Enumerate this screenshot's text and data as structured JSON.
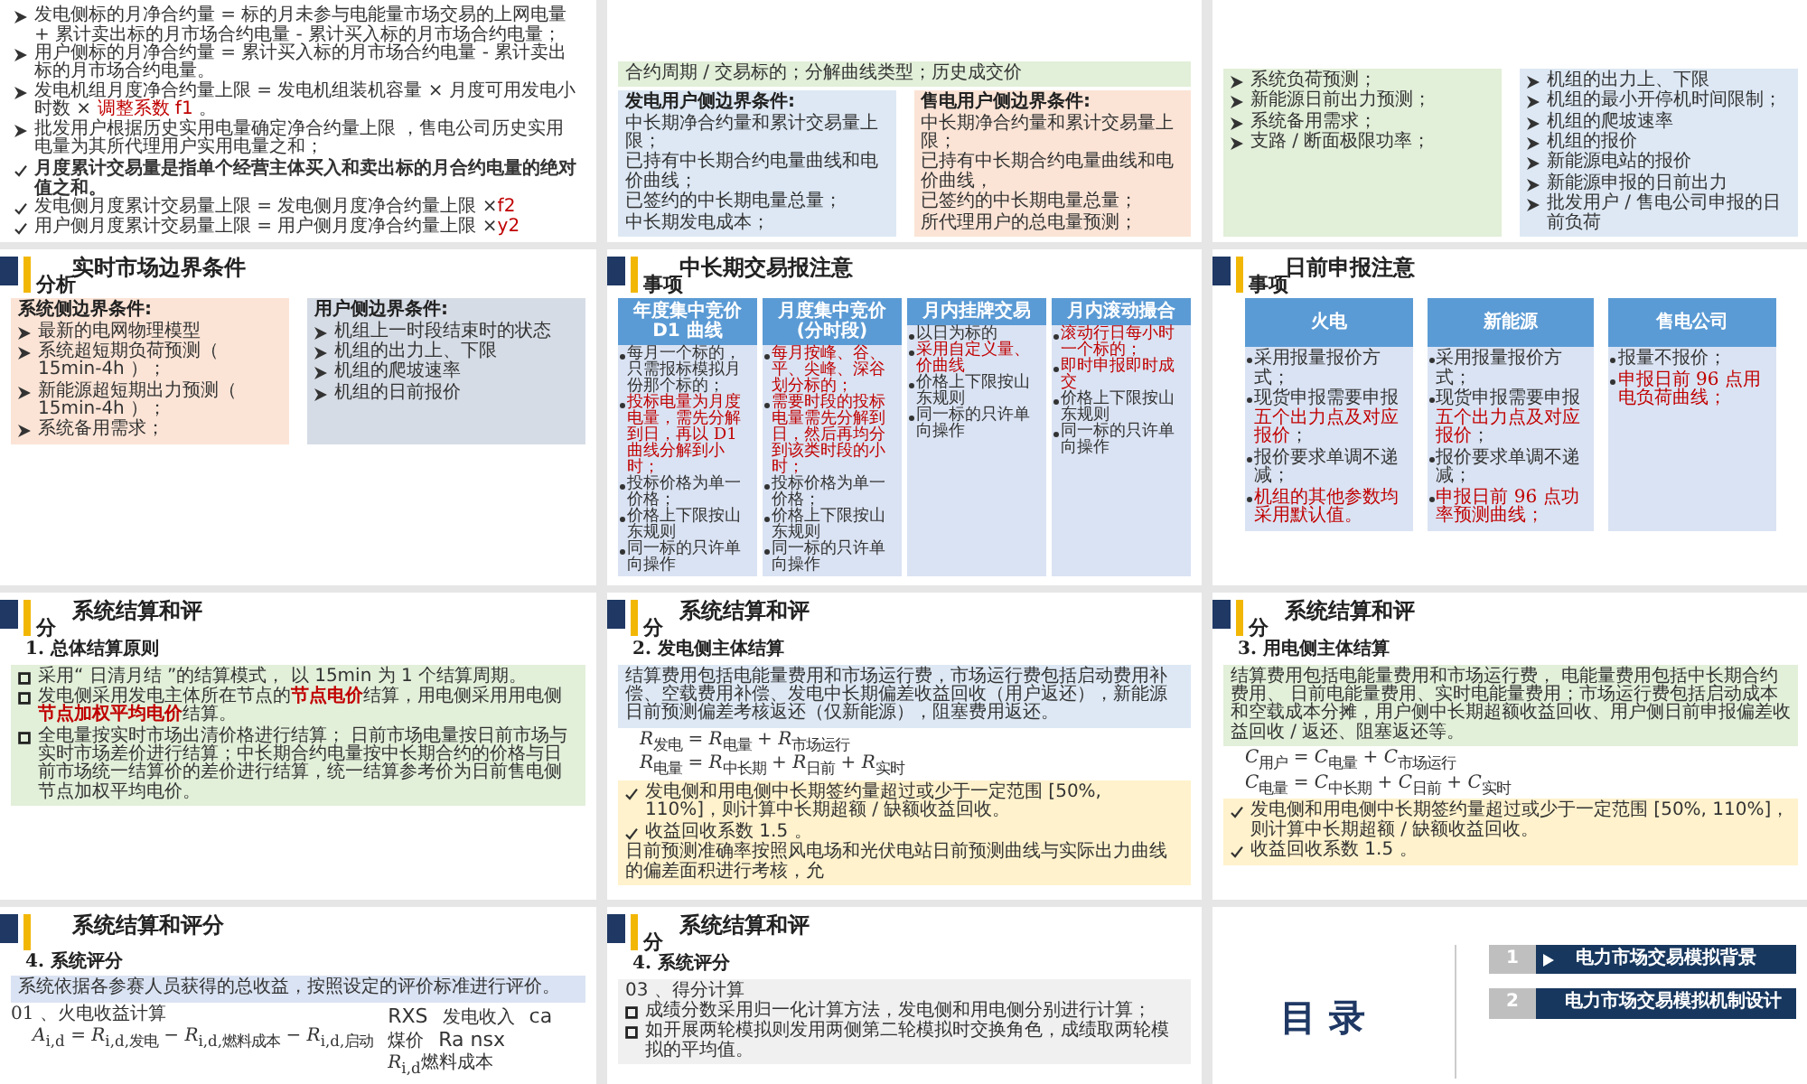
{
  "slides": [
    {
      "kind": "content",
      "blocks": [
        {
          "kind": "box",
          "items": [
            {
              "kind": "arrow",
              "bold": false,
              "parts": [
                {
                  "text": "发电侧标的月净合约量 = 标的月未参与电能量市场交易的上网电量 + 累计卖出标的月市场合约电量 - 累计买入标的月市场合约电量；",
                  "red": false
                }
              ]
            },
            {
              "kind": "arrow",
              "bold": false,
              "parts": [
                {
                  "text": "用户侧标的月净合约量 = 累计买入标的月市场合约电量 - 累计卖出标的月市场合约电量。",
                  "red": false
                }
              ]
            },
            {
              "kind": "arrow",
              "bold": false,
              "parts": [
                {
                  "text": "发电机组月度净合约量上限 = 发电机组装机容量 × 月度可用发电小时数 × ",
                  "red": false
                },
                {
                  "text": "调整系数 f1",
                  "red": true
                },
                {
                  "text": " 。",
                  "red": false
                }
              ]
            },
            {
              "kind": "arrow",
              "bold": false,
              "parts": [
                {
                  "text": "批发用户根据历史实用电量确定净合约量上限 ，售电公司历史实用电量为其所代理用户实用电量之和；",
                  "red": false
                }
              ]
            }
          ]
        },
        {
          "kind": "box",
          "items": [
            {
              "kind": "check",
              "bold": true,
              "parts": [
                {
                  "text": "月度累计交易量是指单个经营主体买入和卖出标的月合约电量的绝对值之和。",
                  "red": false
                }
              ]
            },
            {
              "kind": "check",
              "bold": false,
              "parts": [
                {
                  "text": "发电侧月度累计交易量上限 = 发电侧月度净合约量上限 ×",
                  "red": false
                },
                {
                  "text": "f2",
                  "red": true
                }
              ]
            },
            {
              "kind": "check",
              "bold": false,
              "parts": [
                {
                  "text": "用户侧月度累计交易量上限 = 用户侧月度净合约量上限 ×",
                  "red": false
                },
                {
                  "text": "y2",
                  "red": true
                }
              ]
            }
          ]
        }
      ]
    },
    {
      "kind": "content",
      "blocks": [
        {
          "kind": "box",
          "color": "#e2efd9",
          "items": [
            {
              "kind": "plain",
              "parts": [
                {
                  "text": "合约周期 / 交易标的；分解曲线类型；历史成交价",
                  "red": false
                }
              ]
            }
          ]
        },
        {
          "kind": "row",
          "boxes": [
            {
              "color": "#dde8f4",
              "heading": "发电用户侧边界条件:",
              "items": [
                {
                  "kind": "plain",
                  "parts": [
                    {
                      "text": "中长期净合约量和累计交易量上限；",
                      "red": false
                    }
                  ]
                },
                {
                  "kind": "plain",
                  "parts": [
                    {
                      "text": "已持有中长期合约电量曲线和电价曲线；",
                      "red": false
                    }
                  ]
                },
                {
                  "kind": "plain",
                  "parts": [
                    {
                      "text": "已签约的中长期电量总量；",
                      "red": false
                    }
                  ]
                },
                {
                  "kind": "plain",
                  "parts": [
                    {
                      "text": "中长期发电成本；",
                      "red": false
                    }
                  ]
                }
              ]
            },
            {
              "color": "#fbe4d6",
              "heading": "售电用户侧边界条件:",
              "items": [
                {
                  "kind": "plain",
                  "parts": [
                    {
                      "text": "中长期净合约量和累计交易量上限；",
                      "red": false
                    }
                  ]
                },
                {
                  "kind": "plain",
                  "parts": [
                    {
                      "text": "已持有中长期合约电量曲线和电价曲线，",
                      "red": false
                    }
                  ]
                },
                {
                  "kind": "plain",
                  "parts": [
                    {
                      "text": "已签约的中长期电量总量；",
                      "red": false
                    }
                  ]
                },
                {
                  "kind": "plain",
                  "parts": [
                    {
                      "text": "所代理用户的总电量预测；",
                      "red": false
                    }
                  ]
                }
              ]
            }
          ]
        }
      ]
    },
    {
      "kind": "content",
      "blocks": [
        {
          "kind": "row",
          "boxes": [
            {
              "color": "#e2efd9",
              "items": [
                {
                  "kind": "arrow",
                  "parts": [
                    {
                      "text": "系统负荷预测；",
                      "red": false
                    }
                  ]
                },
                {
                  "kind": "arrow",
                  "parts": [
                    {
                      "text": "新能源日前出力预测；",
                      "red": false
                    }
                  ]
                },
                {
                  "kind": "arrow",
                  "parts": [
                    {
                      "text": "系统备用需求；",
                      "red": false
                    }
                  ]
                },
                {
                  "kind": "arrow",
                  "parts": [
                    {
                      "text": "支路 / 断面极限功率；",
                      "red": false
                    }
                  ]
                }
              ]
            },
            {
              "color": "#dde8f4",
              "items": [
                {
                  "kind": "arrow",
                  "parts": [
                    {
                      "text": "机组的出力上、下限",
                      "red": false
                    }
                  ]
                },
                {
                  "kind": "arrow",
                  "parts": [
                    {
                      "text": "机组的最小开停机时间限制；",
                      "red": false
                    }
                  ]
                },
                {
                  "kind": "arrow",
                  "parts": [
                    {
                      "text": "机组的爬坡速率",
                      "red": false
                    }
                  ]
                },
                {
                  "kind": "arrow",
                  "parts": [
                    {
                      "text": "机组的报价",
                      "red": false
                    }
                  ]
                },
                {
                  "kind": "arrow",
                  "parts": [
                    {
                      "text": "新能源电站的报价",
                      "red": false
                    }
                  ]
                },
                {
                  "kind": "arrow",
                  "parts": [
                    {
                      "text": "新能源申报的日前出力",
                      "red": false
                    }
                  ]
                },
                {
                  "kind": "arrow",
                  "parts": [
                    {
                      "text": "批发用户 / 售电公司申报的日前负荷",
                      "red": false
                    }
                  ]
                }
              ]
            }
          ]
        }
      ]
    },
    {
      "kind": "content",
      "title": "实时市场边界条件",
      "title_tail": "分析",
      "blocks": [
        {
          "kind": "row",
          "boxes": [
            {
              "color": "#fbe4d6",
              "heading": "系统侧边界条件:",
              "items": [
                {
                  "kind": "arrow",
                  "parts": [
                    {
                      "text": "最新的电网物理模型",
                      "red": false
                    }
                  ]
                },
                {
                  "kind": "arrow",
                  "parts": [
                    {
                      "text": "系统超短期负荷预测（ 15min-4h ）；",
                      "red": false
                    }
                  ]
                },
                {
                  "kind": "arrow",
                  "parts": [
                    {
                      "text": "新能源超短期出力预测（ 15min-4h ）；",
                      "red": false
                    }
                  ]
                },
                {
                  "kind": "arrow",
                  "parts": [
                    {
                      "text": "系统备用需求；",
                      "red": false
                    }
                  ]
                }
              ]
            },
            {
              "color": "#d6dce5",
              "heading": "用户侧边界条件:",
              "items": [
                {
                  "kind": "arrow",
                  "parts": [
                    {
                      "text": "机组上一时段结束时的状态",
                      "red": false
                    }
                  ]
                },
                {
                  "kind": "arrow",
                  "parts": [
                    {
                      "text": "机组的出力上、下限",
                      "red": false
                    }
                  ]
                },
                {
                  "kind": "arrow",
                  "parts": [
                    {
                      "text": "机组的爬坡速率",
                      "red": false
                    }
                  ]
                },
                {
                  "kind": "arrow",
                  "parts": [
                    {
                      "text": "机组的日前报价",
                      "red": false
                    }
                  ]
                }
              ]
            }
          ]
        }
      ]
    },
    {
      "kind": "content",
      "title": "中长期交易报注意",
      "title_tail": "事项",
      "blocks": [
        {
          "kind": "cards",
          "cards": [
            {
              "header": "年度集中竞价\nD1 曲线",
              "items": [
                {
                  "parts": [
                    {
                      "text": "每月一个标的，只需报标模拟月份那个标的；",
                      "red": false
                    }
                  ]
                },
                {
                  "parts": [
                    {
                      "text": "投标电量为月度电量，需先分解到日，再以 D1 曲线分解到小时；",
                      "red": true
                    }
                  ]
                },
                {
                  "parts": [
                    {
                      "text": "投标价格为单一价格；",
                      "red": false
                    }
                  ]
                },
                {
                  "parts": [
                    {
                      "text": "价格上下限按山东规则",
                      "red": false
                    }
                  ]
                },
                {
                  "parts": [
                    {
                      "text": "同一标的只许单向操作",
                      "red": false
                    }
                  ]
                }
              ]
            },
            {
              "header": "月度集中竞价\n(分时段)",
              "items": [
                {
                  "parts": [
                    {
                      "text": "每月按峰、谷、平、尖峰、深谷划分标的；",
                      "red": true
                    }
                  ]
                },
                {
                  "parts": [
                    {
                      "text": "需要时段的投标电量需先分解到日，然后再均分到该类时段的小时；",
                      "red": true
                    }
                  ]
                },
                {
                  "parts": [
                    {
                      "text": "投标价格为单一价格；",
                      "red": false
                    }
                  ]
                },
                {
                  "parts": [
                    {
                      "text": "价格上下限按山东规则",
                      "red": false
                    }
                  ]
                },
                {
                  "parts": [
                    {
                      "text": "同一标的只许单向操作",
                      "red": false
                    }
                  ]
                }
              ]
            },
            {
              "header": "月内挂牌交易",
              "items": [
                {
                  "parts": [
                    {
                      "text": "以日为标的",
                      "red": false
                    }
                  ]
                },
                {
                  "parts": [
                    {
                      "text": "采用自定义量、价曲线",
                      "red": true
                    }
                  ]
                },
                {
                  "parts": [
                    {
                      "text": "价格上下限按山东规则",
                      "red": false
                    }
                  ]
                },
                {
                  "parts": [
                    {
                      "text": "同一标的只许单向操作",
                      "red": false
                    }
                  ]
                }
              ]
            },
            {
              "header": "月内滚动撮合",
              "items": [
                {
                  "parts": [
                    {
                      "text": "滚动行日每小时一个标的；",
                      "red": true
                    }
                  ]
                },
                {
                  "parts": [
                    {
                      "text": "即时申报即时成交",
                      "red": true
                    }
                  ]
                },
                {
                  "parts": [
                    {
                      "text": "价格上下限按山东规则",
                      "red": false
                    }
                  ]
                },
                {
                  "parts": [
                    {
                      "text": "同一标的只许单向操作",
                      "red": false
                    }
                  ]
                }
              ]
            }
          ]
        }
      ]
    },
    {
      "kind": "content",
      "title": "日前申报注意",
      "title_tail": "事项",
      "blocks": [
        {
          "kind": "cards",
          "cards": [
            {
              "header": "火电",
              "items": [
                {
                  "parts": [
                    {
                      "text": "采用报量报价方式；",
                      "red": false
                    }
                  ]
                },
                {
                  "parts": [
                    {
                      "text": "现货申报需要申报",
                      "red": false
                    },
                    {
                      "text": "五个出力点及对应报价",
                      "red": true
                    },
                    {
                      "text": "；",
                      "red": false
                    }
                  ]
                },
                {
                  "parts": [
                    {
                      "text": "报价要求单调不递减；",
                      "red": false
                    }
                  ]
                },
                {
                  "parts": [
                    {
                      "text": "机组的其他参数均采用默认值。",
                      "red": true
                    }
                  ]
                }
              ]
            },
            {
              "header": "新能源",
              "items": [
                {
                  "parts": [
                    {
                      "text": "采用报量报价方式；",
                      "red": false
                    }
                  ]
                },
                {
                  "parts": [
                    {
                      "text": "现货申报需要申报",
                      "red": false
                    },
                    {
                      "text": "五个出力点及对应报价",
                      "red": true
                    },
                    {
                      "text": "；",
                      "red": false
                    }
                  ]
                },
                {
                  "parts": [
                    {
                      "text": "报价要求单调不递减；",
                      "red": false
                    }
                  ]
                },
                {
                  "parts": [
                    {
                      "text": "申报日前 96 点功率预测曲线；",
                      "red": true
                    }
                  ]
                }
              ]
            },
            {
              "header": "售电公司",
              "items": [
                {
                  "parts": [
                    {
                      "text": "报量不报价；",
                      "red": false
                    }
                  ]
                },
                {
                  "parts": [
                    {
                      "text": "申报日前 96 点用电负荷曲线；",
                      "red": true
                    }
                  ]
                }
              ]
            }
          ]
        }
      ]
    },
    {
      "kind": "content",
      "title": "系统结算和评",
      "title_tail": "分",
      "blocks": [
        {
          "kind": "heading",
          "text": "1. 总体结算原则"
        },
        {
          "kind": "box",
          "color": "#e2efd9",
          "items": [
            {
              "kind": "square",
              "parts": [
                {
                  "text": "采用“ 日清月结 ”的结算模式， 以 15min 为 1 个结算周期。",
                  "red": false
                }
              ]
            },
            {
              "kind": "square",
              "parts": [
                {
                  "text": "发电侧采用发电主体所在节点的",
                  "red": false
                },
                {
                  "text": "**节点电价**",
                  "red": true
                },
                {
                  "text": "结算，用电侧采用用电侧",
                  "red": false
                },
                {
                  "text": "**节点加权平均电价**",
                  "red": true
                },
                {
                  "text": "结算。",
                  "red": false
                }
              ]
            },
            {
              "kind": "square",
              "parts": [
                {
                  "text": "全电量按实时市场出清价格进行结算； 日前市场电量按日前市场与实时市场差价进行结算；中长期合约电量按中长期合约的价格与日前市场统一结算价的差价进行结算，统一结算参考价为日前售电侧节点加权平均电价。",
                  "red": false
                }
              ]
            }
          ]
        }
      ]
    },
    {
      "kind": "content",
      "title": "系统结算和评",
      "title_tail": "分",
      "blocks": [
        {
          "kind": "heading",
          "text": "2. 发电侧主体结算"
        },
        {
          "kind": "box",
          "color": "#dde8f4",
          "items": [
            {
              "kind": "plain",
              "parts": [
                {
                  "text": "结算费用包括电能量费用和市场运行费，市场运行费包括启动费用补偿、空载费用补偿、发电中长期偏差收益回收（用户返还），新能源日前预测偏差考核返还（仅新能源），阻塞费用返还。",
                  "red": false
                }
              ]
            }
          ]
        },
        {
          "kind": "formula",
          "text": "*R*$_{发电}$ = *R*$_{电量}$ + *R*$_{市场运行}$"
        },
        {
          "kind": "formula",
          "text": "*R*$_{电量}$ = *R*$_{中长期}$ + *R*$_{日前}$ + *R*$_{实时}$"
        },
        {
          "kind": "box",
          "color": "#fff2cc",
          "items": [
            {
              "kind": "check",
              "parts": [
                {
                  "text": "发电侧和用电侧中长期签约量超过或少于一定范围 [50%, 110%]，则计算中长期超额 / 缺额收益回收。",
                  "red": false
                }
              ]
            },
            {
              "kind": "check",
              "parts": [
                {
                  "text": "收益回收系数 1.5 。",
                  "red": false
                }
              ]
            },
            {
              "kind": "plain",
              "parts": [
                {
                  "text": "日前预测准确率按照风电场和光伏电站日前预测曲线与实际出力曲线的偏差面积进行考核，允",
                  "red": false
                }
              ]
            }
          ]
        }
      ]
    },
    {
      "kind": "content",
      "title": "系统结算和评",
      "title_tail": "分",
      "blocks": [
        {
          "kind": "heading",
          "text": "3. 用电侧主体结算"
        },
        {
          "kind": "box",
          "color": "#e2efd9",
          "items": [
            {
              "kind": "plain",
              "parts": [
                {
                  "text": "结算费用包括电能量费用和市场运行费， 电能量费用包括中长期合约费用、 日前电能量费用、实时电能量费用；市场运行费包括启动成本和空载成本分摊，用户侧中长期超额收益回收、用户侧日前申报偏差收益回收 / 返还、阻塞返还等。",
                  "red": false
                }
              ]
            }
          ]
        },
        {
          "kind": "formula",
          "text": "*C*$_{用户}$ = *C*$_{电量}$ + *C*$_{市场运行}$"
        },
        {
          "kind": "formula",
          "text": "*C*$_{电量}$ = *C*$_{中长期}$ + *C*$_{日前}$ + *C*$_{实时}$"
        },
        {
          "kind": "box",
          "color": "#fff2cc",
          "items": [
            {
              "kind": "check",
              "parts": [
                {
                  "text": "发电侧和用电侧中长期签约量超过或少于一定范围 [50%, 110%]，则计算中长期超额 / 缺额收益回收。",
                  "red": false
                }
              ]
            },
            {
              "kind": "check",
              "parts": [
                {
                  "text": "收益回收系数 1.5 。",
                  "red": false
                }
              ]
            }
          ]
        }
      ]
    },
    {
      "kind": "content",
      "title": "系统结算和评分",
      "blocks": [
        {
          "kind": "heading",
          "text": "4. 系统评分"
        },
        {
          "kind": "box",
          "color": "#dae3f3",
          "items": [
            {
              "kind": "plain",
              "parts": [
                {
                  "text": "系统依据各参赛人员获得的总收益，按照设定的评价标准进行评价。",
                  "red": false
                }
              ]
            }
          ]
        },
        {
          "kind": "calc",
          "label": "01 、火电收益计算",
          "formula": "*A*$_{i,d}$ = *R*$_{i,d,发电}$ − *R*$_{i,d,燃料成本}$ − *R*$_{i,d,启动}$",
          "terms": [
            {
              "kind": "symbol",
              "text": "RXS"
            },
            {
              "kind": "label",
              "text": "发电收入"
            },
            {
              "kind": "symbol",
              "text": "ca"
            },
            {
              "kind": "label",
              "text": "煤价"
            },
            {
              "kind": "symbol",
              "text": "Ra nsx"
            },
            {
              "kind": "label",
              "text": "*R*$_{i,d}$燃料成本"
            }
          ]
        }
      ]
    },
    {
      "kind": "content",
      "title": "系统结算和评",
      "title_tail": "分",
      "blocks": [
        {
          "kind": "heading",
          "text": "4. 系统评分"
        },
        {
          "kind": "box",
          "color": "#f0f0f0",
          "items": [
            {
              "kind": "plain",
              "parts": [
                {
                  "text": "03 、得分计算",
                  "red": false
                }
              ]
            },
            {
              "kind": "square",
              "parts": [
                {
                  "text": "成绩分数采用归一化计算方法，发电侧和用电侧分别进行计算；",
                  "red": false
                }
              ]
            },
            {
              "kind": "square",
              "parts": [
                {
                  "text": "如开展两轮模拟则发用两侧第二轮模拟时交换角色，成绩取两轮模拟的平均值。",
                  "red": false
                }
              ]
            }
          ]
        }
      ]
    },
    {
      "kind": "toc",
      "title": "目 录",
      "items": [
        {
          "number": "1",
          "label": "电力市场交易模拟背景"
        },
        {
          "number": "2",
          "label": "电力市场交易模拟机制设计"
        }
      ]
    }
  ]
}
